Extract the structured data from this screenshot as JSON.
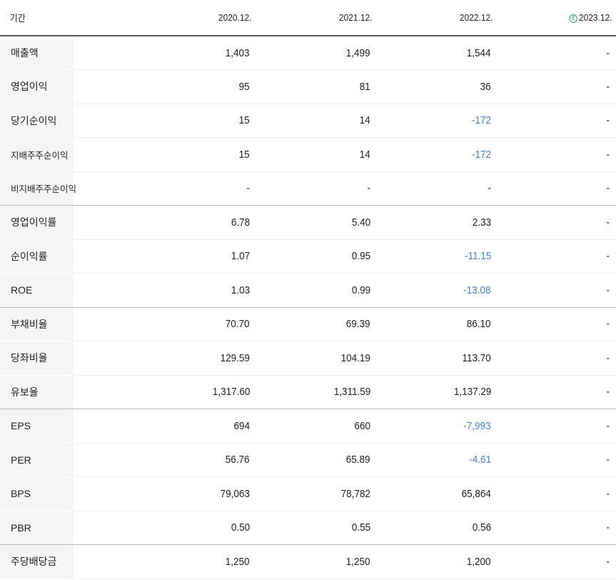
{
  "header": {
    "label": "기간",
    "periods": [
      "2020.12.",
      "2021.12.",
      "2022.12.",
      "2023.12."
    ],
    "estimate_badge": "E"
  },
  "colors": {
    "negative": "#3d86d8",
    "estimate_badge": "#1aa548",
    "label_bg": "#f5f5f5"
  },
  "rows": [
    {
      "label": "매출액",
      "values": [
        "1,403",
        "1,499",
        "1,544",
        "-"
      ]
    },
    {
      "label": "영업이익",
      "values": [
        "95",
        "81",
        "36",
        "-"
      ]
    },
    {
      "label": "당기순이익",
      "values": [
        "15",
        "14",
        "-172",
        "-"
      ]
    },
    {
      "label": "지배주주순이익",
      "values": [
        "15",
        "14",
        "-172",
        "-"
      ]
    },
    {
      "label": "비지배주주순이익",
      "values": [
        "-",
        "-",
        "-",
        "-"
      ]
    },
    {
      "label": "영업이익률",
      "values": [
        "6.78",
        "5.40",
        "2.33",
        "-"
      ]
    },
    {
      "label": "순이익률",
      "values": [
        "1.07",
        "0.95",
        "-11.15",
        "-"
      ]
    },
    {
      "label": "ROE",
      "values": [
        "1.03",
        "0.99",
        "-13.08",
        "-"
      ]
    },
    {
      "label": "부채비율",
      "values": [
        "70.70",
        "69.39",
        "86.10",
        "-"
      ]
    },
    {
      "label": "당좌비율",
      "values": [
        "129.59",
        "104.19",
        "113.70",
        "-"
      ]
    },
    {
      "label": "유보율",
      "values": [
        "1,317.60",
        "1,311.59",
        "1,137.29",
        "-"
      ]
    },
    {
      "label": "EPS",
      "values": [
        "694",
        "660",
        "-7,993",
        "-"
      ]
    },
    {
      "label": "PER",
      "values": [
        "56.76",
        "65.89",
        "-4.61",
        "-"
      ]
    },
    {
      "label": "BPS",
      "values": [
        "79,063",
        "78,782",
        "65,864",
        "-"
      ]
    },
    {
      "label": "PBR",
      "values": [
        "0.50",
        "0.55",
        "0.56",
        "-"
      ]
    },
    {
      "label": "주당배당금",
      "values": [
        "1,250",
        "1,250",
        "1,200",
        "-"
      ]
    }
  ]
}
